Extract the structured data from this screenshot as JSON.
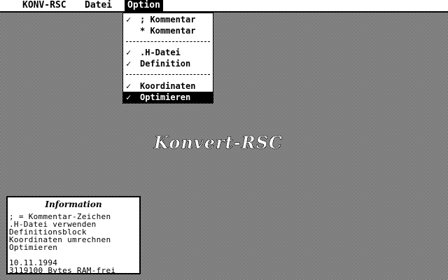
{
  "menubar": {
    "items": [
      {
        "label": "KONV-RSC"
      },
      {
        "label": "Datei"
      },
      {
        "label": "Option",
        "active": true
      }
    ]
  },
  "option_menu": {
    "items": [
      {
        "label": "; Kommentar",
        "checked": true,
        "check": "✓"
      },
      {
        "label": "* Kommentar",
        "checked": false,
        "check": ""
      },
      {
        "label": ".H-Datei",
        "checked": true,
        "check": "✓"
      },
      {
        "label": "Definition",
        "checked": true,
        "check": "✓"
      },
      {
        "label": "Koordinaten",
        "checked": true,
        "check": "✓"
      },
      {
        "label": "Optimieren",
        "checked": true,
        "check": "✓",
        "selected": true
      }
    ]
  },
  "watermark": {
    "text": "Konvert-RSC"
  },
  "info_panel": {
    "title": "Information",
    "lines": [
      "; = Kommentar-Zeichen",
      ".H-Datei verwenden",
      "Definitionsblock",
      "Koordinaten umrechnen",
      "Optimieren",
      "",
      "10.11.1994",
      "3119100 Bytes RAM-frei"
    ]
  },
  "colors": {
    "foreground": "#000000",
    "background": "#ffffff"
  }
}
